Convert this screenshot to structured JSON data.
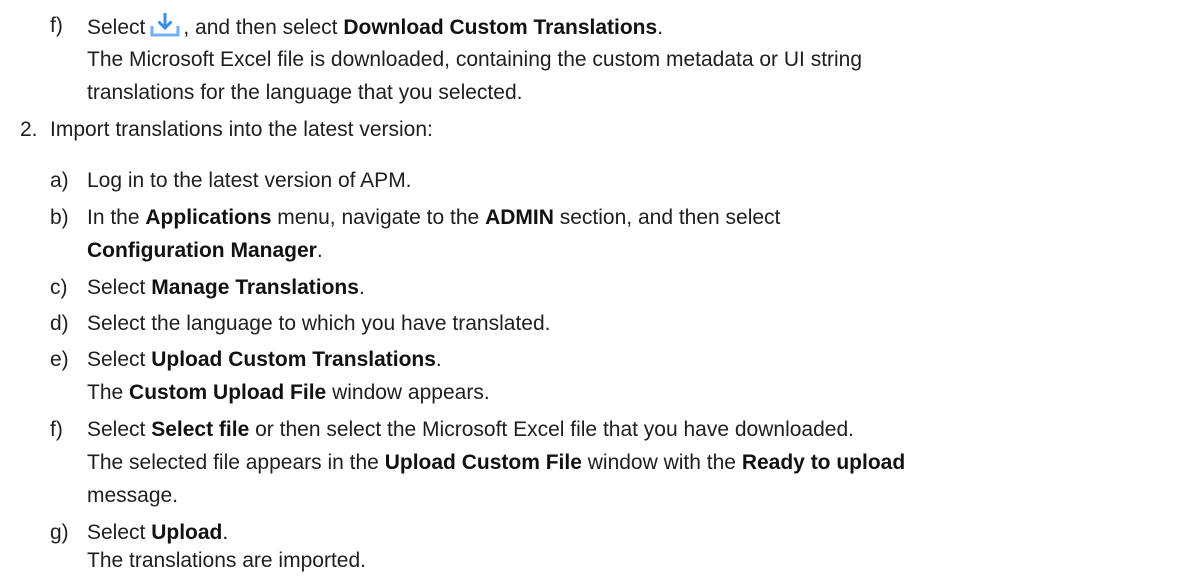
{
  "step1f": {
    "label": "f)",
    "p1": "Select",
    "icon": "download-icon",
    "p2": ", and then select",
    "b1": "Download Custom Translations",
    "p3": ".",
    "r2": "The Microsoft Excel file is downloaded, containing the custom metadata or UI string",
    "r3": "translations for the language that you selected."
  },
  "step2": {
    "label": "2.",
    "text": "Import translations into the latest version:",
    "a": {
      "label": "a)",
      "text": "Log in to the latest version of APM."
    },
    "b": {
      "label": "b)",
      "p1": "In the",
      "b1": "Applications",
      "p2": "menu, navigate to the",
      "b2": "ADMIN",
      "p3": "section, and then select",
      "b3": "Configuration Manager",
      "p4": "."
    },
    "c": {
      "label": "c)",
      "p1": "Select",
      "b1": "Manage Translations",
      "p2": "."
    },
    "d": {
      "label": "d)",
      "text": "Select the language to which you have translated."
    },
    "e": {
      "label": "e)",
      "p1": "Select",
      "b1": "Upload Custom Translations",
      "p2": ".",
      "r2p1": "The",
      "r2b1": "Custom Upload File",
      "r2p2": "window appears."
    },
    "f": {
      "label": "f)",
      "p1": "Select",
      "b1": "Select file",
      "p2": "or then select the Microsoft Excel file that you have downloaded.",
      "r2p1": "The selected file appears in the",
      "r2b1": "Upload Custom File",
      "r2p2": "window with the",
      "r2b2": "Ready to upload",
      "r3": "message."
    },
    "g": {
      "label": "g)",
      "p1": "Select",
      "b1": "Upload",
      "p2": ".",
      "r2": "The translations are imported."
    }
  },
  "colors": {
    "text": "#1e1e1e",
    "icon": "#3b8ee5"
  }
}
